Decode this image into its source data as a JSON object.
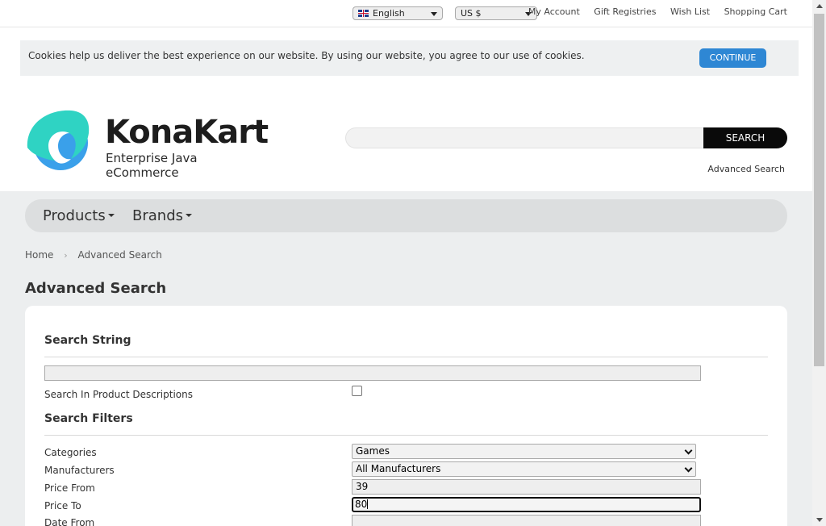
{
  "topbar": {
    "language": "English",
    "currency": "US $",
    "links": [
      "My Account",
      "Gift Registries",
      "Wish List",
      "Shopping Cart"
    ]
  },
  "cookie": {
    "message": "Cookies help us deliver the best experience on our website. By using our website, you agree to our use of cookies.",
    "button": "CONTINUE"
  },
  "header": {
    "logo_title": "KonaKart",
    "logo_subtitle": "Enterprise Java eCommerce",
    "search_value": "",
    "search_button": "SEARCH",
    "advanced_link": "Advanced Search"
  },
  "nav": {
    "items": [
      "Products",
      "Brands"
    ]
  },
  "breadcrumb": {
    "home": "Home",
    "current": "Advanced Search"
  },
  "page_title": "Advanced Search",
  "form": {
    "section1_title": "Search String",
    "search_string_value": "",
    "search_desc_label": "Search In Product Descriptions",
    "search_desc_checked": false,
    "section2_title": "Search Filters",
    "categories_label": "Categories",
    "categories_value": "Games",
    "manufacturers_label": "Manufacturers",
    "manufacturers_value": "All Manufacturers",
    "price_from_label": "Price From",
    "price_from_value": "39",
    "price_to_label": "Price To",
    "price_to_value": "80",
    "date_from_label": "Date From",
    "date_from_value": ""
  },
  "colors": {
    "accent": "#2e87d4",
    "logo_teal": "#2fd3c3",
    "logo_blue": "#3aa0ea",
    "search_button": "#0a0a0a"
  }
}
